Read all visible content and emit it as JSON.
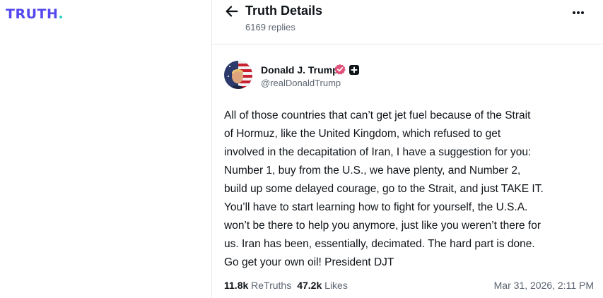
{
  "logo": {
    "text": "TRUTH",
    "dot": "."
  },
  "header": {
    "title": "Truth Details",
    "replies": "6169 replies"
  },
  "post": {
    "author": {
      "name": "Donald J. Trump",
      "handle": "@realDonaldTrump"
    },
    "body_lines": [
      "All of those countries that can’t get jet fuel because of the Strait",
      "of Hormuz, like the United Kingdom, which refused to get",
      "involved in the decapitation of Iran, I have a suggestion for you:",
      "Number 1, buy from the U.S., we have plenty, and Number 2,",
      "build up some delayed courage, go to the Strait, and just TAKE IT.",
      "You’ll have to start learning how to fight for yourself, the U.S.A.",
      "won’t be there to help you anymore, just like you weren’t there for",
      "us. Iran has been, essentially, decimated. The hard part is done.",
      "Go get your own oil! President DJT"
    ],
    "stats": {
      "retruths_count": "11.8k",
      "retruths_label": "ReTruths",
      "likes_count": "47.2k",
      "likes_label": "Likes"
    },
    "timestamp": "Mar 31, 2026, 2:11 PM"
  },
  "colors": {
    "brand": "#5448ee",
    "brand_dot": "#17cdbf",
    "verified": "#e0527a",
    "secondary_text": "#5b6470"
  },
  "icons": {
    "back": "arrow-left-icon",
    "more": "more-horizontal-icon",
    "verified": "verified-badge-icon",
    "plus": "plus-square-icon"
  }
}
